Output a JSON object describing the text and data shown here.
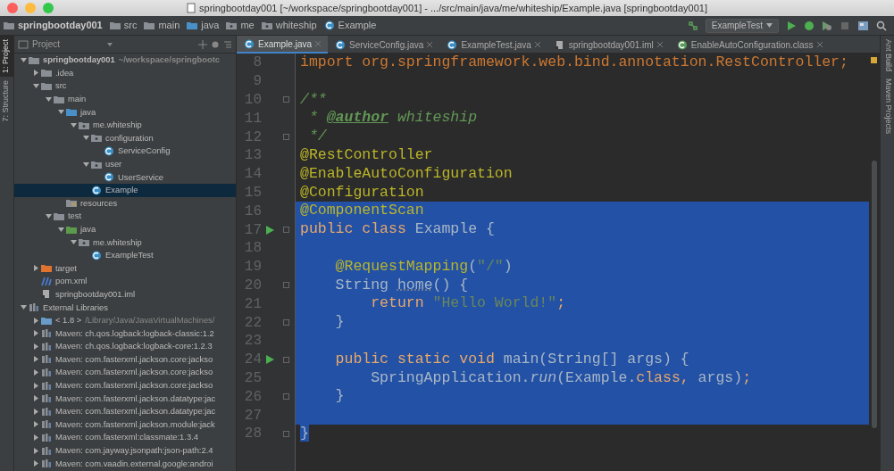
{
  "window": {
    "title": "springbootday001 [~/workspace/springbootday001] - .../src/main/java/me/whiteship/Example.java [springbootday001]"
  },
  "breadcrumbs": [
    {
      "label": "springbootday001",
      "kind": "module"
    },
    {
      "label": "src",
      "kind": "folder"
    },
    {
      "label": "main",
      "kind": "folder"
    },
    {
      "label": "java",
      "kind": "source"
    },
    {
      "label": "me",
      "kind": "package"
    },
    {
      "label": "whiteship",
      "kind": "package"
    },
    {
      "label": "Example",
      "kind": "class"
    }
  ],
  "run_config": {
    "label": "ExampleTest"
  },
  "project_panel": {
    "title": "Project"
  },
  "left_stripe": [
    {
      "label": "1: Project",
      "selected": true
    },
    {
      "label": "7: Structure",
      "selected": false
    }
  ],
  "right_stripe": [
    {
      "label": "Ant Build"
    },
    {
      "label": "Maven Projects"
    }
  ],
  "tabs": [
    {
      "label": "Example.java",
      "kind": "class",
      "selected": true
    },
    {
      "label": "ServiceConfig.java",
      "kind": "class",
      "selected": false
    },
    {
      "label": "ExampleTest.java",
      "kind": "class",
      "selected": false
    },
    {
      "label": "springbootday001.iml",
      "kind": "iml",
      "selected": false
    },
    {
      "label": "EnableAutoConfiguration.class",
      "kind": "annotation",
      "selected": false
    }
  ],
  "tree": [
    {
      "label": "springbootday001",
      "hint": "~/workspace/springbootc",
      "kind": "module",
      "expanded": true,
      "selected": false,
      "children": [
        {
          "label": ".idea",
          "kind": "folder",
          "expanded": false,
          "selected": false
        },
        {
          "label": "src",
          "kind": "folder",
          "expanded": true,
          "selected": false,
          "children": [
            {
              "label": "main",
              "kind": "folder",
              "expanded": true,
              "selected": false,
              "children": [
                {
                  "label": "java",
                  "kind": "source",
                  "expanded": true,
                  "selected": false,
                  "children": [
                    {
                      "label": "me.whiteship",
                      "kind": "package",
                      "expanded": true,
                      "selected": false,
                      "children": [
                        {
                          "label": "configuration",
                          "kind": "package",
                          "expanded": true,
                          "selected": false,
                          "children": [
                            {
                              "label": "ServiceConfig",
                              "kind": "class",
                              "selected": false
                            }
                          ]
                        },
                        {
                          "label": "user",
                          "kind": "package",
                          "expanded": true,
                          "selected": false,
                          "children": [
                            {
                              "label": "UserService",
                              "kind": "class",
                              "selected": false
                            }
                          ]
                        },
                        {
                          "label": "Example",
                          "kind": "class",
                          "selected": true
                        }
                      ]
                    }
                  ]
                },
                {
                  "label": "resources",
                  "kind": "resources",
                  "selected": false
                }
              ]
            },
            {
              "label": "test",
              "kind": "folder",
              "expanded": true,
              "selected": false,
              "children": [
                {
                  "label": "java",
                  "kind": "test",
                  "expanded": true,
                  "selected": false,
                  "children": [
                    {
                      "label": "me.whiteship",
                      "kind": "package",
                      "expanded": true,
                      "selected": false,
                      "children": [
                        {
                          "label": "ExampleTest",
                          "kind": "class",
                          "selected": false
                        }
                      ]
                    }
                  ]
                }
              ]
            }
          ]
        },
        {
          "label": "target",
          "kind": "excluded",
          "expanded": false,
          "selected": false
        },
        {
          "label": "pom.xml",
          "kind": "maven",
          "selected": false
        },
        {
          "label": "springbootday001.iml",
          "kind": "iml",
          "selected": false
        }
      ]
    },
    {
      "label": "External Libraries",
      "kind": "libraries",
      "expanded": true,
      "selected": false,
      "children": [
        {
          "label": "< 1.8 >",
          "hint": "/Library/Java/JavaVirtualMachines/",
          "kind": "jdk",
          "expanded": false,
          "selected": false
        },
        {
          "label": "Maven: ch.qos.logback:logback-classic:1.2",
          "kind": "library",
          "expanded": false,
          "selected": false
        },
        {
          "label": "Maven: ch.qos.logback:logback-core:1.2.3",
          "kind": "library",
          "expanded": false,
          "selected": false
        },
        {
          "label": "Maven: com.fasterxml.jackson.core:jackso",
          "kind": "library",
          "expanded": false,
          "selected": false
        },
        {
          "label": "Maven: com.fasterxml.jackson.core:jackso",
          "kind": "library",
          "expanded": false,
          "selected": false
        },
        {
          "label": "Maven: com.fasterxml.jackson.core:jackso",
          "kind": "library",
          "expanded": false,
          "selected": false
        },
        {
          "label": "Maven: com.fasterxml.jackson.datatype:jac",
          "kind": "library",
          "expanded": false,
          "selected": false
        },
        {
          "label": "Maven: com.fasterxml.jackson.datatype:jac",
          "kind": "library",
          "expanded": false,
          "selected": false
        },
        {
          "label": "Maven: com.fasterxml.jackson.module:jack",
          "kind": "library",
          "expanded": false,
          "selected": false
        },
        {
          "label": "Maven: com.fasterxml:classmate:1.3.4",
          "kind": "library",
          "expanded": false,
          "selected": false
        },
        {
          "label": "Maven: com.jayway.jsonpath:json-path:2.4",
          "kind": "library",
          "expanded": false,
          "selected": false
        },
        {
          "label": "Maven: com.vaadin.external.google:androi",
          "kind": "library",
          "expanded": false,
          "selected": false
        }
      ]
    }
  ],
  "code": [
    {
      "number": "8",
      "selected": false,
      "tokens": [
        {
          "kind": "keyword",
          "text": "import org.springframework.web.bind.annotation.RestController;"
        }
      ]
    },
    {
      "number": "9",
      "selected": false
    },
    {
      "number": "10",
      "selected": false,
      "fold": true,
      "tokens": [
        {
          "kind": "doc",
          "text": "/**"
        }
      ]
    },
    {
      "number": "11",
      "selected": false,
      "tokens": [
        {
          "kind": "doc",
          "text": " * "
        },
        {
          "kind": "tag",
          "text": "@author"
        },
        {
          "kind": "doc",
          "text": " whiteship"
        }
      ]
    },
    {
      "number": "12",
      "selected": false,
      "fold": true,
      "tokens": [
        {
          "kind": "doc",
          "text": " */"
        }
      ]
    },
    {
      "number": "13",
      "selected": false,
      "tokens": [
        {
          "kind": "annotation",
          "text": "@RestController"
        }
      ]
    },
    {
      "number": "14",
      "selected": false,
      "tokens": [
        {
          "kind": "annotation",
          "text": "@EnableAutoConfiguration"
        }
      ]
    },
    {
      "number": "15",
      "selected": false,
      "tokens": [
        {
          "kind": "annotation",
          "text": "@Configuration"
        }
      ]
    },
    {
      "number": "16",
      "selected": true,
      "tokens": [
        {
          "kind": "annotation",
          "text": "@ComponentScan"
        }
      ]
    },
    {
      "number": "17",
      "selected": true,
      "run": true,
      "fold": true,
      "tokens": [
        {
          "kind": "keyword",
          "text": "public class "
        },
        {
          "kind": "plain",
          "text": "Example {"
        }
      ]
    },
    {
      "number": "18",
      "selected": true
    },
    {
      "number": "19",
      "selected": true,
      "tokens": [
        {
          "kind": "annotation",
          "text": "    @RequestMapping"
        },
        {
          "kind": "plain",
          "text": "("
        },
        {
          "kind": "string",
          "text": "\"/\""
        },
        {
          "kind": "plain",
          "text": ")"
        }
      ]
    },
    {
      "number": "20",
      "selected": true,
      "fold": true,
      "tokens": [
        {
          "kind": "plain",
          "text": "    String "
        },
        {
          "kind": "unused",
          "text": "home"
        },
        {
          "kind": "plain",
          "text": "() {"
        }
      ]
    },
    {
      "number": "21",
      "selected": true,
      "tokens": [
        {
          "kind": "keyword",
          "text": "        return "
        },
        {
          "kind": "string",
          "text": "\"Hello World!\""
        },
        {
          "kind": "keyword",
          "text": ";"
        }
      ]
    },
    {
      "number": "22",
      "selected": true,
      "fold": true,
      "tokens": [
        {
          "kind": "plain",
          "text": "    }"
        }
      ]
    },
    {
      "number": "23",
      "selected": true
    },
    {
      "number": "24",
      "selected": true,
      "run": true,
      "fold": true,
      "tokens": [
        {
          "kind": "keyword",
          "text": "    public static void "
        },
        {
          "kind": "plain",
          "text": "main(String[] args) {"
        }
      ]
    },
    {
      "number": "25",
      "selected": true,
      "tokens": [
        {
          "kind": "plain",
          "text": "        SpringApplication."
        },
        {
          "kind": "static",
          "text": "run"
        },
        {
          "kind": "plain",
          "text": "(Example."
        },
        {
          "kind": "keyword",
          "text": "class, "
        },
        {
          "kind": "plain",
          "text": "args)"
        },
        {
          "kind": "keyword",
          "text": ";"
        }
      ]
    },
    {
      "number": "26",
      "selected": true,
      "fold": true,
      "tokens": [
        {
          "kind": "plain",
          "text": "    }"
        }
      ]
    },
    {
      "number": "27",
      "selected": true
    },
    {
      "number": "28",
      "selected": true,
      "fold": true,
      "tokens": [
        {
          "kind": "plain",
          "text": "}"
        }
      ]
    }
  ]
}
